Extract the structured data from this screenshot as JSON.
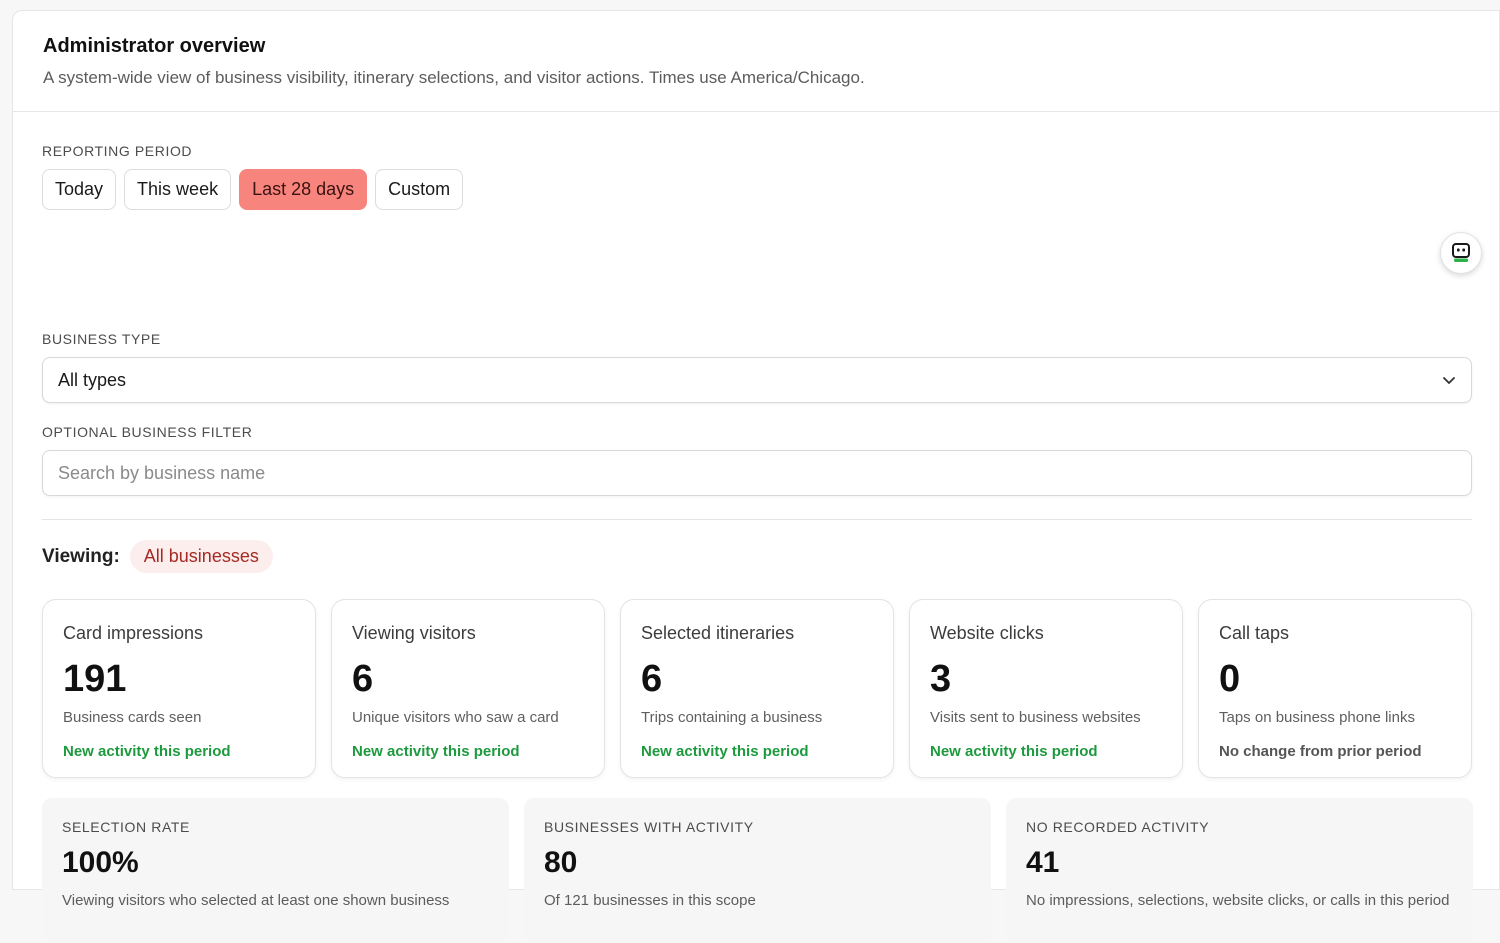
{
  "header": {
    "title": "Administrator overview",
    "subtitle": "A system-wide view of business visibility, itinerary selections, and visitor actions. Times use America/Chicago."
  },
  "filters": {
    "period_label": "REPORTING PERIOD",
    "period_options": [
      "Today",
      "This week",
      "Last 28 days",
      "Custom"
    ],
    "period_selected": "Last 28 days",
    "type_label": "BUSINESS TYPE",
    "type_value": "All types",
    "filter_label": "OPTIONAL BUSINESS FILTER",
    "search_placeholder": "Search by business name",
    "search_value": ""
  },
  "viewing": {
    "label": "Viewing:",
    "scope": "All businesses"
  },
  "cards": [
    {
      "title": "Card impressions",
      "value": "191",
      "sub": "Business cards seen",
      "trend": "New activity this period",
      "trend_kind": "up"
    },
    {
      "title": "Viewing visitors",
      "value": "6",
      "sub": "Unique visitors who saw a card",
      "trend": "New activity this period",
      "trend_kind": "up"
    },
    {
      "title": "Selected itineraries",
      "value": "6",
      "sub": "Trips containing a business",
      "trend": "New activity this period",
      "trend_kind": "up"
    },
    {
      "title": "Website clicks",
      "value": "3",
      "sub": "Visits sent to business websites",
      "trend": "New activity this period",
      "trend_kind": "up"
    },
    {
      "title": "Call taps",
      "value": "0",
      "sub": "Taps on business phone links",
      "trend": "No change from prior period",
      "trend_kind": "flat"
    }
  ],
  "stats": [
    {
      "label": "SELECTION RATE",
      "value": "100%",
      "desc": "Viewing visitors who selected at least one shown business"
    },
    {
      "label": "BUSINESSES WITH ACTIVITY",
      "value": "80",
      "desc": "Of 121 businesses in this scope"
    },
    {
      "label": "NO RECORDED ACTIVITY",
      "value": "41",
      "desc": "No impressions, selections, website clicks, or calls in this period"
    }
  ],
  "colors": {
    "accent": "#f7857d",
    "trend_up": "#1e9a3e",
    "badge_text": "#a52a23",
    "badge_bg": "#fdeeee"
  },
  "icons": {
    "assistant": "robot-icon",
    "select": "chevron-down-icon"
  }
}
